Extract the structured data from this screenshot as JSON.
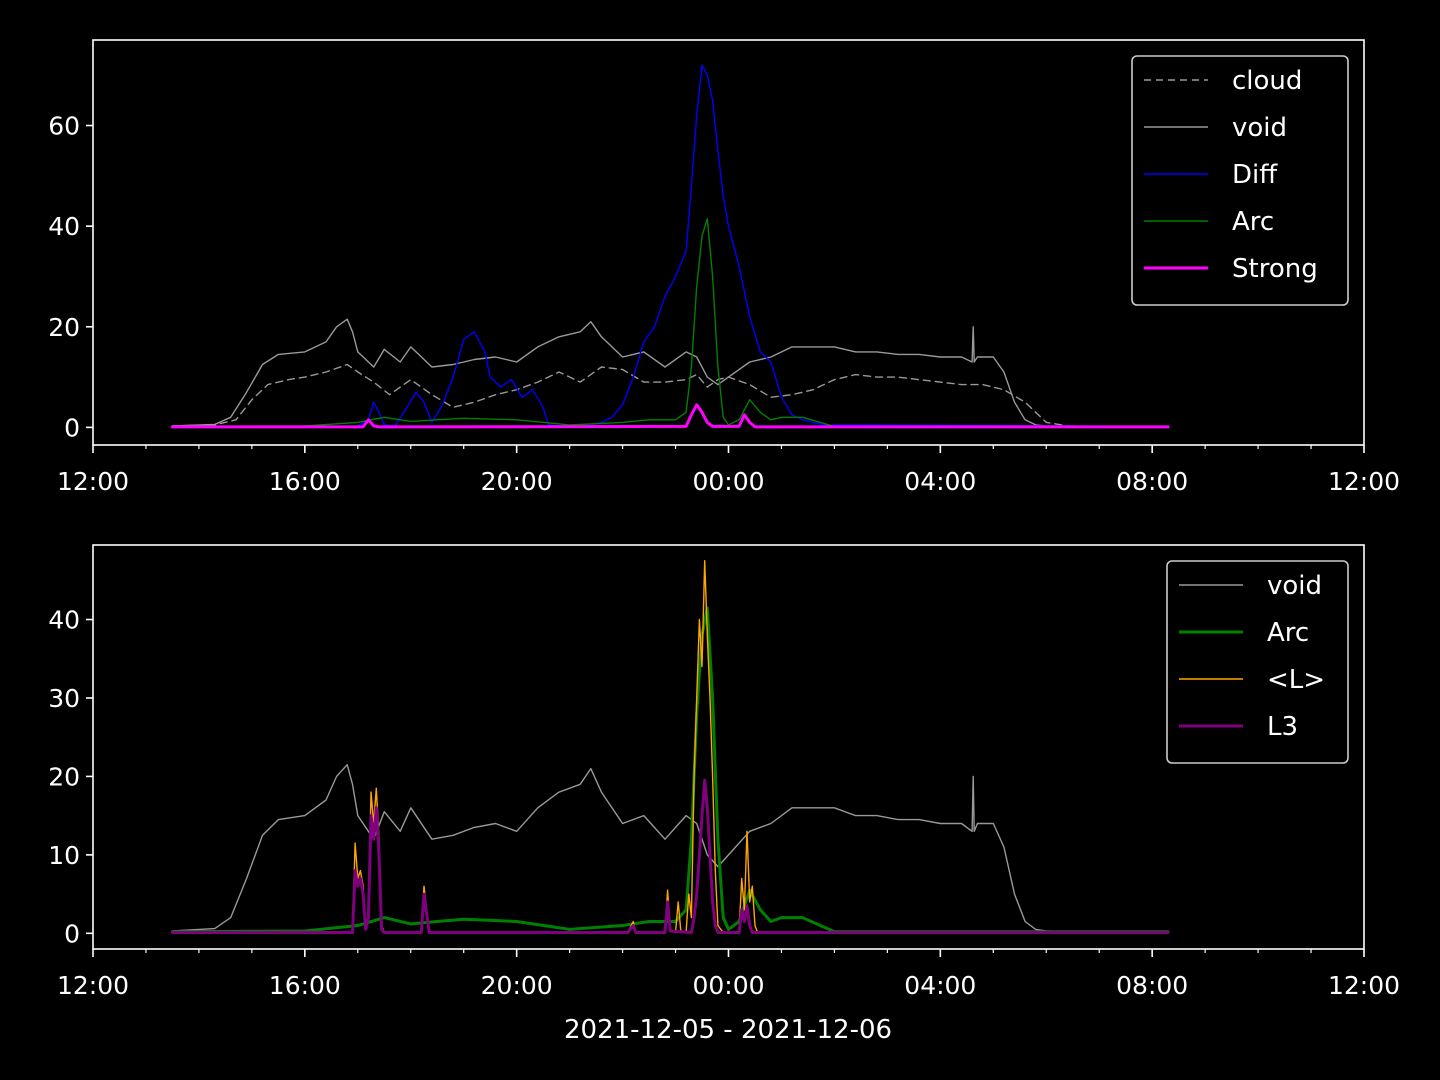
{
  "figure": {
    "background": "#000000",
    "foreground": "#ffffff",
    "xlabel": "2021-12-05 - 2021-12-06"
  },
  "chart_data": [
    {
      "type": "line",
      "panel": "top",
      "x_unit": "hours since 2021-12-05 00:00",
      "xlim": [
        12,
        36
      ],
      "ylim": [
        -3.5,
        77
      ],
      "yticks": [
        0,
        20,
        40,
        60
      ],
      "xticks": [
        12,
        16,
        20,
        24,
        28,
        32,
        36
      ],
      "xticklabels": [
        "12:00",
        "16:00",
        "20:00",
        "00:00",
        "04:00",
        "08:00",
        "12:00"
      ],
      "legend_position": "upper right",
      "series": [
        {
          "name": "cloud",
          "color": "#999999",
          "style": "dashed",
          "width": 1.4,
          "x": [
            13.5,
            14.3,
            14.7,
            15.0,
            15.3,
            15.7,
            16.0,
            16.4,
            16.8,
            17.0,
            17.3,
            17.6,
            18.0,
            18.4,
            18.8,
            19.2,
            19.6,
            20.0,
            20.4,
            20.8,
            21.2,
            21.6,
            22.0,
            22.4,
            22.8,
            23.2,
            23.4,
            23.6,
            23.8,
            24.0,
            24.4,
            24.8,
            25.2,
            25.6,
            26.0,
            26.4,
            26.8,
            27.2,
            27.6,
            28.0,
            28.4,
            28.8,
            29.2,
            29.6,
            30.0,
            30.4,
            30.8,
            31.2,
            31.6,
            32.0,
            32.3
          ],
          "y": [
            0.3,
            0.5,
            1.5,
            5.5,
            8.5,
            9.5,
            10.0,
            11.0,
            12.5,
            11.0,
            9.0,
            6.5,
            9.5,
            6.5,
            4.0,
            5.0,
            6.5,
            7.5,
            9.0,
            11.0,
            9.0,
            12.0,
            11.5,
            9.0,
            9.0,
            9.5,
            10.5,
            8.0,
            9.5,
            10.0,
            8.5,
            6.0,
            6.5,
            7.5,
            9.5,
            10.5,
            10.0,
            10.0,
            9.5,
            9.0,
            8.5,
            8.5,
            7.5,
            5.0,
            1.0,
            0.3,
            0.2,
            0.2,
            0.2,
            0.2,
            0.2
          ]
        },
        {
          "name": "void",
          "color": "#999999",
          "style": "solid",
          "width": 1.4,
          "x": [
            13.5,
            14.3,
            14.6,
            14.9,
            15.2,
            15.5,
            16.0,
            16.4,
            16.6,
            16.8,
            16.9,
            17.0,
            17.3,
            17.5,
            17.8,
            18.0,
            18.4,
            18.8,
            19.2,
            19.6,
            20.0,
            20.4,
            20.8,
            21.2,
            21.4,
            21.6,
            22.0,
            22.4,
            22.8,
            23.2,
            23.4,
            23.6,
            23.8,
            24.0,
            24.4,
            24.8,
            25.2,
            25.6,
            26.0,
            26.4,
            26.8,
            27.2,
            27.6,
            28.0,
            28.4,
            28.6,
            28.62,
            28.64,
            28.7,
            29.0,
            29.2,
            29.4,
            29.6,
            29.8,
            30.0,
            30.4,
            30.8,
            31.2,
            31.6,
            32.0,
            32.3
          ],
          "y": [
            0.3,
            0.6,
            2.0,
            7.0,
            12.5,
            14.5,
            15.0,
            17.0,
            20.0,
            21.5,
            19.0,
            15.0,
            12.0,
            15.5,
            13.0,
            16.0,
            12.0,
            12.5,
            13.5,
            14.0,
            13.0,
            16.0,
            18.0,
            19.0,
            21.0,
            18.0,
            14.0,
            15.0,
            12.0,
            15.0,
            14.0,
            10.0,
            8.5,
            10.0,
            13.0,
            14.0,
            16.0,
            16.0,
            16.0,
            15.0,
            15.0,
            14.5,
            14.5,
            14.0,
            14.0,
            13.0,
            20.0,
            13.0,
            14.0,
            14.0,
            11.0,
            5.0,
            1.5,
            0.5,
            0.3,
            0.2,
            0.2,
            0.2,
            0.2,
            0.2,
            0.2
          ]
        },
        {
          "name": "Diff",
          "color": "#0000ff",
          "style": "solid",
          "width": 1.4,
          "x": [
            13.5,
            16.5,
            17.0,
            17.2,
            17.3,
            17.4,
            17.5,
            17.7,
            17.9,
            18.1,
            18.25,
            18.4,
            18.6,
            18.8,
            19.0,
            19.2,
            19.4,
            19.5,
            19.7,
            19.9,
            20.1,
            20.3,
            20.5,
            20.6,
            21.0,
            21.2,
            21.4,
            21.6,
            21.8,
            22.0,
            22.2,
            22.4,
            22.6,
            22.8,
            23.0,
            23.2,
            23.3,
            23.4,
            23.5,
            23.6,
            23.7,
            23.8,
            23.9,
            24.0,
            24.2,
            24.4,
            24.6,
            24.8,
            25.0,
            25.2,
            25.4,
            25.6,
            25.8,
            32.3
          ],
          "y": [
            0.2,
            0.2,
            0.3,
            1.5,
            5.0,
            3.0,
            0.5,
            0.3,
            3.5,
            7.0,
            5.0,
            1.0,
            4.5,
            10.0,
            17.5,
            19.0,
            15.0,
            10.0,
            8.0,
            9.5,
            6.0,
            7.5,
            4.0,
            0.5,
            0.2,
            0.2,
            0.5,
            1.0,
            2.0,
            4.5,
            10.0,
            17.0,
            20.0,
            26.0,
            30.0,
            35.0,
            48.0,
            62.0,
            72.0,
            70.0,
            65.0,
            55.0,
            46.0,
            40.0,
            32.0,
            22.0,
            15.0,
            13.0,
            6.0,
            2.5,
            1.5,
            1.0,
            0.5,
            0.2
          ]
        },
        {
          "name": "Arc",
          "color": "#008000",
          "style": "solid",
          "width": 1.4,
          "x": [
            13.5,
            16.0,
            17.0,
            17.5,
            18.0,
            18.5,
            19.0,
            20.0,
            21.0,
            22.0,
            22.5,
            23.0,
            23.2,
            23.3,
            23.4,
            23.5,
            23.6,
            23.7,
            23.8,
            23.9,
            24.0,
            24.2,
            24.4,
            24.6,
            24.8,
            25.0,
            25.4,
            25.8,
            26.0,
            32.3
          ],
          "y": [
            0.2,
            0.3,
            1.0,
            2.0,
            1.2,
            1.5,
            1.8,
            1.5,
            0.5,
            1.0,
            1.5,
            1.5,
            3.0,
            12.0,
            28.0,
            38.0,
            41.5,
            30.0,
            12.0,
            2.0,
            0.5,
            1.5,
            5.5,
            3.0,
            1.5,
            2.0,
            2.0,
            0.8,
            0.2,
            0.2
          ]
        },
        {
          "name": "Strong",
          "color": "#ff00ff",
          "style": "solid",
          "width": 3.0,
          "x": [
            13.5,
            17.1,
            17.2,
            17.3,
            17.4,
            23.2,
            23.3,
            23.4,
            23.5,
            23.6,
            23.7,
            24.2,
            24.3,
            24.4,
            24.5,
            32.3
          ],
          "y": [
            0.1,
            0.1,
            1.5,
            0.3,
            0.1,
            0.2,
            2.5,
            4.5,
            3.0,
            1.0,
            0.2,
            0.2,
            2.5,
            1.0,
            0.1,
            0.1
          ]
        }
      ]
    },
    {
      "type": "line",
      "panel": "bottom",
      "x_unit": "hours since 2021-12-05 00:00",
      "xlim": [
        12,
        36
      ],
      "ylim": [
        -2.0,
        49.5
      ],
      "yticks": [
        0,
        10,
        20,
        30,
        40
      ],
      "xticks": [
        12,
        16,
        20,
        24,
        28,
        32,
        36
      ],
      "xticklabels": [
        "12:00",
        "16:00",
        "20:00",
        "00:00",
        "04:00",
        "08:00",
        "12:00"
      ],
      "xlabel": "2021-12-05 - 2021-12-06",
      "legend_position": "upper right",
      "series": [
        {
          "name": "void",
          "color": "#999999",
          "style": "solid",
          "width": 1.4,
          "x": [
            13.5,
            14.3,
            14.6,
            14.9,
            15.2,
            15.5,
            16.0,
            16.4,
            16.6,
            16.8,
            16.9,
            17.0,
            17.3,
            17.5,
            17.8,
            18.0,
            18.4,
            18.8,
            19.2,
            19.6,
            20.0,
            20.4,
            20.8,
            21.2,
            21.4,
            21.6,
            22.0,
            22.4,
            22.8,
            23.2,
            23.4,
            23.6,
            23.8,
            24.0,
            24.4,
            24.8,
            25.2,
            25.6,
            26.0,
            26.4,
            26.8,
            27.2,
            27.6,
            28.0,
            28.4,
            28.6,
            28.62,
            28.64,
            28.7,
            29.0,
            29.2,
            29.4,
            29.6,
            29.8,
            30.0,
            30.4,
            30.8,
            31.2,
            31.6,
            32.0,
            32.3
          ],
          "y": [
            0.3,
            0.6,
            2.0,
            7.0,
            12.5,
            14.5,
            15.0,
            17.0,
            20.0,
            21.5,
            19.0,
            15.0,
            12.0,
            15.5,
            13.0,
            16.0,
            12.0,
            12.5,
            13.5,
            14.0,
            13.0,
            16.0,
            18.0,
            19.0,
            21.0,
            18.0,
            14.0,
            15.0,
            12.0,
            15.0,
            14.0,
            10.0,
            8.5,
            10.0,
            13.0,
            14.0,
            16.0,
            16.0,
            16.0,
            15.0,
            15.0,
            14.5,
            14.5,
            14.0,
            14.0,
            13.0,
            20.0,
            13.0,
            14.0,
            14.0,
            11.0,
            5.0,
            1.5,
            0.5,
            0.3,
            0.2,
            0.2,
            0.2,
            0.2,
            0.2,
            0.2
          ]
        },
        {
          "name": "Arc",
          "color": "#008000",
          "style": "solid",
          "width": 3.0,
          "x": [
            13.5,
            16.0,
            17.0,
            17.5,
            18.0,
            18.5,
            19.0,
            20.0,
            21.0,
            22.0,
            22.5,
            23.0,
            23.2,
            23.3,
            23.4,
            23.5,
            23.6,
            23.7,
            23.8,
            23.9,
            24.0,
            24.2,
            24.4,
            24.6,
            24.8,
            25.0,
            25.4,
            25.8,
            26.0,
            32.3
          ],
          "y": [
            0.2,
            0.3,
            1.0,
            2.0,
            1.2,
            1.5,
            1.8,
            1.5,
            0.5,
            1.0,
            1.5,
            1.5,
            3.0,
            12.0,
            28.0,
            38.0,
            41.5,
            30.0,
            12.0,
            2.0,
            0.5,
            1.5,
            5.5,
            3.0,
            1.5,
            2.0,
            2.0,
            0.8,
            0.2,
            0.2
          ]
        },
        {
          "name": "<L>",
          "color": "#ffa500",
          "style": "solid",
          "width": 1.4,
          "x": [
            13.5,
            16.9,
            16.95,
            17.0,
            17.05,
            17.1,
            17.15,
            17.2,
            17.25,
            17.3,
            17.35,
            17.4,
            17.45,
            17.5,
            18.2,
            18.25,
            18.3,
            18.35,
            22.1,
            22.2,
            22.25,
            22.8,
            22.85,
            22.9,
            23.0,
            23.05,
            23.1,
            23.2,
            23.25,
            23.3,
            23.35,
            23.4,
            23.45,
            23.5,
            23.55,
            23.6,
            23.65,
            23.7,
            23.75,
            23.8,
            23.9,
            24.2,
            24.25,
            24.3,
            24.35,
            24.4,
            24.45,
            24.5,
            24.55,
            32.3
          ],
          "y": [
            0.1,
            0.1,
            11.5,
            7.0,
            8.0,
            6.0,
            1.0,
            2.0,
            18.0,
            14.0,
            18.5,
            12.0,
            1.0,
            0.1,
            0.2,
            6.0,
            3.0,
            0.1,
            0.1,
            1.5,
            0.1,
            0.1,
            5.5,
            0.5,
            0.1,
            4.0,
            0.3,
            0.2,
            5.0,
            2.0,
            20.0,
            30.0,
            40.0,
            34.0,
            47.5,
            38.0,
            30.0,
            20.0,
            8.0,
            1.0,
            0.1,
            0.2,
            7.0,
            3.0,
            13.0,
            4.0,
            6.0,
            1.0,
            0.1,
            0.1
          ]
        },
        {
          "name": "L3",
          "color": "#800080",
          "style": "solid",
          "width": 3.0,
          "x": [
            13.5,
            16.9,
            16.95,
            17.0,
            17.05,
            17.1,
            17.15,
            17.2,
            17.25,
            17.3,
            17.35,
            17.4,
            17.45,
            17.5,
            18.2,
            18.25,
            18.3,
            18.35,
            22.1,
            22.2,
            22.25,
            22.8,
            22.85,
            22.9,
            23.3,
            23.35,
            23.4,
            23.45,
            23.5,
            23.55,
            23.6,
            23.65,
            23.7,
            23.75,
            23.8,
            24.2,
            24.25,
            24.3,
            24.35,
            24.4,
            24.45,
            32.3
          ],
          "y": [
            0.1,
            0.1,
            8.0,
            6.0,
            7.0,
            5.0,
            0.5,
            2.0,
            15.0,
            12.0,
            16.0,
            10.0,
            0.5,
            0.1,
            0.1,
            5.0,
            2.5,
            0.1,
            0.1,
            1.0,
            0.1,
            0.1,
            4.0,
            0.3,
            0.1,
            2.0,
            5.0,
            10.0,
            15.0,
            19.5,
            16.0,
            10.0,
            4.0,
            1.0,
            0.1,
            0.1,
            3.0,
            1.5,
            3.5,
            1.0,
            0.1,
            0.1
          ]
        }
      ]
    }
  ]
}
